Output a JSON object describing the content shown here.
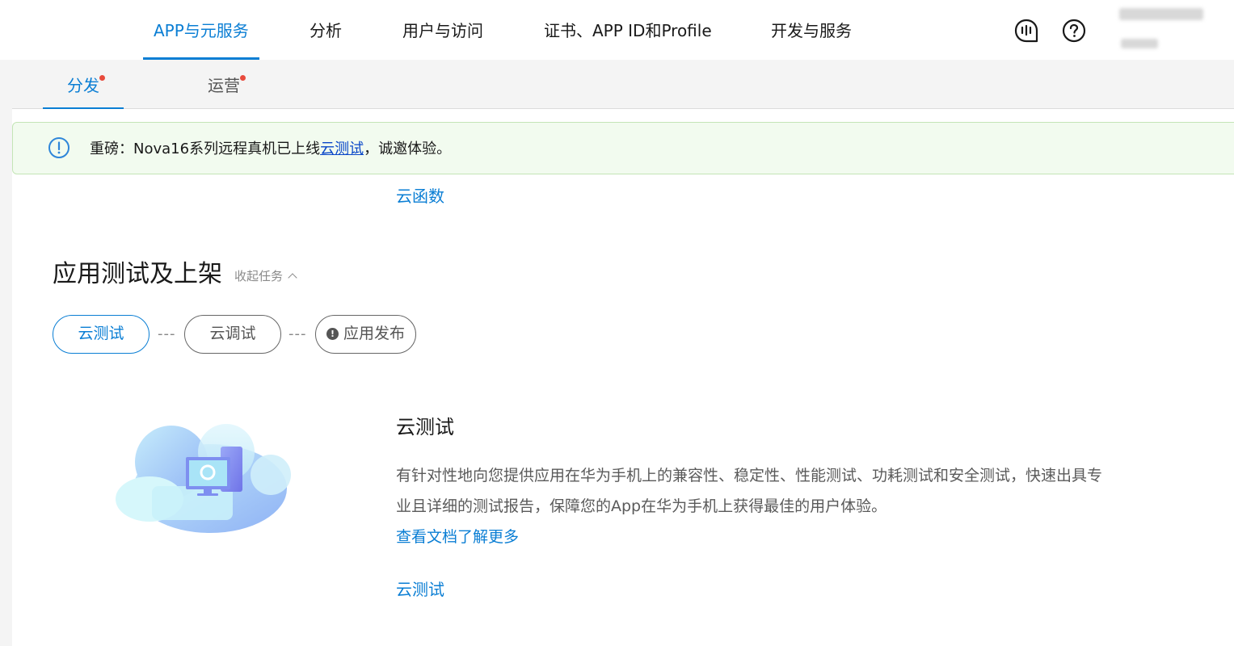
{
  "top_nav": {
    "items": [
      {
        "label": "APP与元服务",
        "active": true
      },
      {
        "label": "分析",
        "active": false
      },
      {
        "label": "用户与访问",
        "active": false
      },
      {
        "label": "证书、APP ID和Profile",
        "active": false
      },
      {
        "label": "开发与服务",
        "active": false
      }
    ],
    "icons": [
      "feedback-icon",
      "help-icon"
    ],
    "accent_color": "#0a7ed4"
  },
  "sub_tabs": [
    {
      "label": "分发",
      "active": true,
      "has_dot": true
    },
    {
      "label": "运营",
      "active": false,
      "has_dot": true
    }
  ],
  "notice": {
    "prefix": "重磅：Nova16系列远程真机已上线",
    "link": "云测试",
    "suffix": "，诚邀体验。",
    "icon": "info-icon"
  },
  "cloud_function_link": "云函数",
  "section": {
    "title": "应用测试及上架",
    "collapse_label": "收起任务",
    "steps": [
      {
        "label": "云测试",
        "active": true
      },
      {
        "label": "云调试",
        "active": false
      },
      {
        "label": "应用发布",
        "active": false,
        "icon": "warning-icon"
      }
    ],
    "separator": "---"
  },
  "detail": {
    "title": "云测试",
    "description": "有针对性地向您提供应用在华为手机上的兼容性、稳定性、性能测试、功耗测试和安全测试，快速出具专业且详细的测试报告，保障您的App在华为手机上获得最佳的用户体验。",
    "doc_link": "查看文档了解更多",
    "action_link": "云测试"
  }
}
